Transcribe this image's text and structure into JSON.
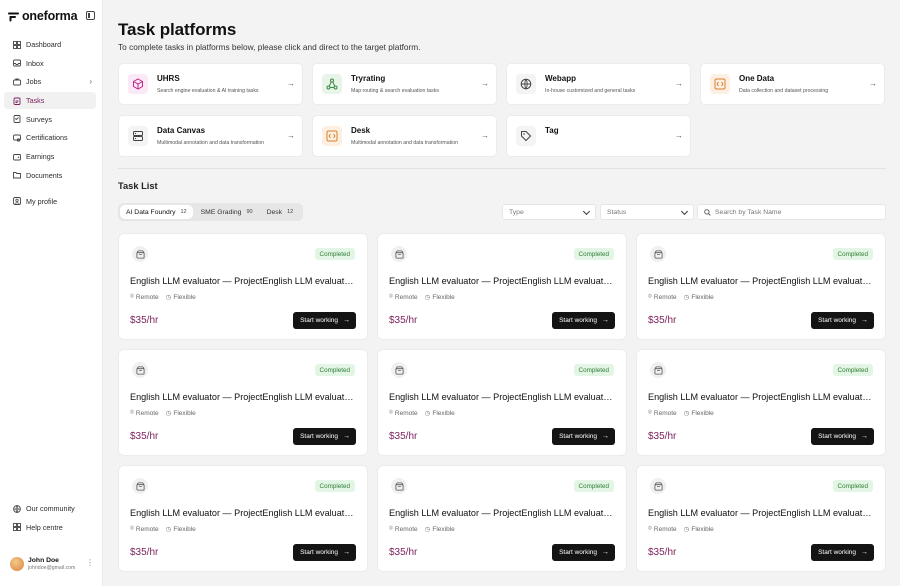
{
  "brand": {
    "name": "oneforma"
  },
  "sidebar": {
    "items": [
      {
        "label": "Dashboard",
        "icon": "dashboard-icon"
      },
      {
        "label": "Inbox",
        "icon": "inbox-icon"
      },
      {
        "label": "Jobs",
        "icon": "briefcase-icon"
      },
      {
        "label": "Tasks",
        "icon": "clipboard-icon"
      },
      {
        "label": "Surveys",
        "icon": "survey-icon"
      },
      {
        "label": "Certifications",
        "icon": "certificate-icon"
      },
      {
        "label": "Earnings",
        "icon": "wallet-icon"
      },
      {
        "label": "Documents",
        "icon": "folder-icon"
      },
      {
        "label": "My profile",
        "icon": "profile-icon"
      }
    ],
    "bottom": [
      {
        "label": "Our community",
        "icon": "globe-icon"
      },
      {
        "label": "Help centre",
        "icon": "help-icon"
      }
    ],
    "user": {
      "name": "John Doe",
      "email": "johndoe@gmail.com"
    }
  },
  "header": {
    "title": "Task platforms",
    "subtitle": "To complete tasks in platforms below, please click and direct to the target platform."
  },
  "platforms": [
    {
      "name": "UHRS",
      "desc": "Search engine evaluation & AI training tasks"
    },
    {
      "name": "Tryrating",
      "desc": "Map routing & search evaluation tasks"
    },
    {
      "name": "Webapp",
      "desc": "In-house customized and general tasks"
    },
    {
      "name": "One Data",
      "desc": "Data collection and dataset processing"
    },
    {
      "name": "Data Canvas",
      "desc": "Multimodal annotation and data transformation"
    },
    {
      "name": "Desk",
      "desc": "Multimodal annotation and data transformation"
    },
    {
      "name": "Tag",
      "desc": ""
    }
  ],
  "task_list": {
    "title": "Task List",
    "tabs": [
      {
        "label": "AI Data Foundry",
        "count": "12"
      },
      {
        "label": "SME Grading",
        "count": "90"
      },
      {
        "label": "Desk",
        "count": "12"
      }
    ],
    "filters": {
      "type_placeholder": "Type",
      "status_placeholder": "Status",
      "search_placeholder": "Search by Task Name"
    },
    "card": {
      "status": "Completed",
      "title": "English LLM evaluator — ProjectEnglish LLM evaluator — Project",
      "location": "Remote",
      "schedule": "Flexible",
      "rate": "$35/hr",
      "cta": "Start working"
    }
  },
  "colors": {
    "accent": "#7a1f5a",
    "badge_bg": "#e3f5e4",
    "badge_text": "#2f7d36"
  }
}
